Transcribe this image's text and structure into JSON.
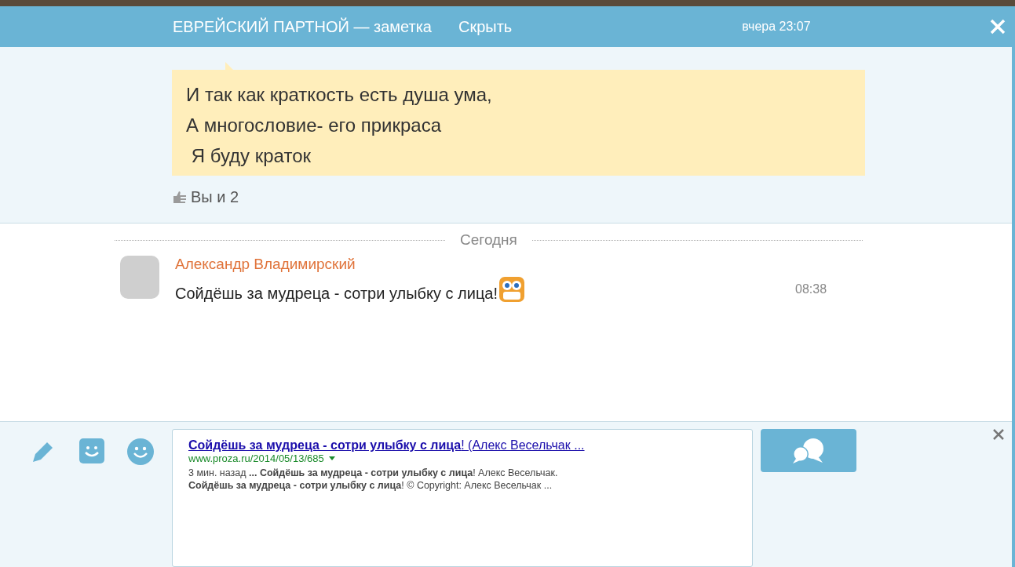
{
  "header": {
    "title": "ЕВРЕЙСКИЙ ПАРТНОЙ — заметка",
    "hide_link": "Скрыть",
    "time": "вчера 23:07"
  },
  "note": {
    "lines": [
      "И так как краткость есть душа ума,",
      "А многословие- его прикраса",
      " Я буду краток"
    ],
    "likes": "Вы и 2"
  },
  "day_divider": "Сегодня",
  "messages": [
    {
      "author": "Александр Владимирский",
      "text": "Сойдёшь за мудреца - сотри улыбку с лица!",
      "time": "08:38"
    }
  ],
  "composer": {
    "snippet": {
      "title": "**Сойдёшь за мудреца - сотри улыбку с лица**! (Алекс Весельчак ...",
      "url": "www.proza.ru/2014/05/13/685",
      "lines": [
        "3 мин. назад **... Сойдёшь за мудреца - сотри улыбку с лица**! Алекс Весельчак.",
        "**Сойдёшь за мудреца - сотри улыбку с лица**! © Copyright: Алекс Весельчак ..."
      ]
    }
  }
}
